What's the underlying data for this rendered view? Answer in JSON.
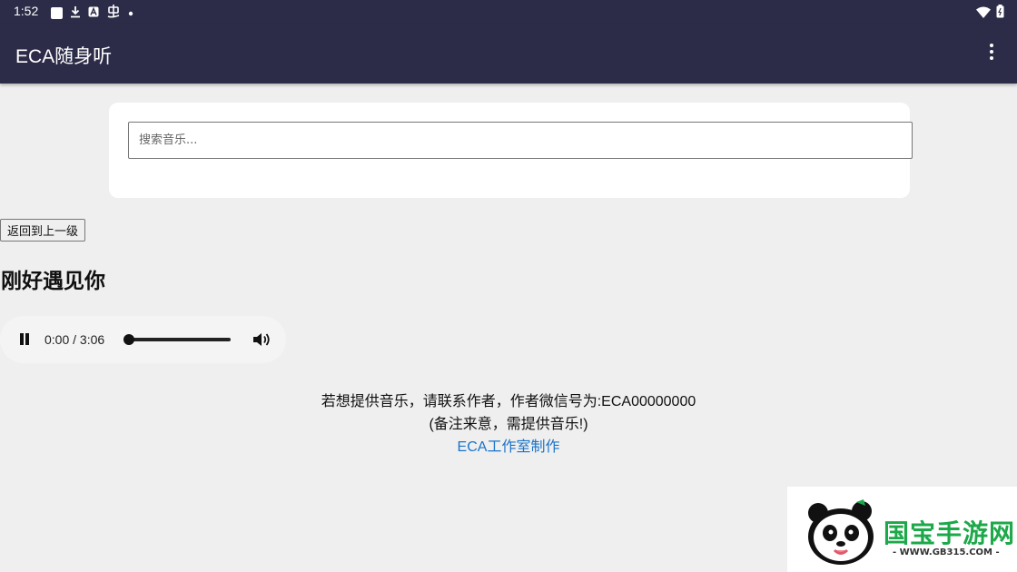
{
  "status_bar": {
    "time": "1:52",
    "left_icons": [
      "notification-square-icon",
      "download-icon",
      "a-box-icon",
      "bug-icon",
      "dot-icon"
    ],
    "right_icons": [
      "wifi-icon",
      "battery-icon"
    ]
  },
  "app_bar": {
    "title": "ECA随身听",
    "menu_icon": "more-vert-icon"
  },
  "search": {
    "placeholder": "搜索音乐..."
  },
  "back_button": {
    "label": "返回到上一级"
  },
  "song": {
    "title": "刚好遇见你"
  },
  "player": {
    "state_icon": "pause-icon",
    "time": "0:00 / 3:06",
    "progress": 0,
    "volume_icon": "volume-icon"
  },
  "footer": {
    "line1": "若想提供音乐，请联系作者，作者微信号为:ECA00000000",
    "line2": "(备注来意，需提供音乐!)",
    "link": "ECA工作室制作"
  },
  "watermark": {
    "logo": "panda-logo",
    "text": "国宝手游网",
    "url": "- WWW.GB315.COM -"
  },
  "colors": {
    "app_bar": "#2c2c48",
    "background": "#efefef",
    "link": "#1a73c8",
    "watermark_green": "#1da84a"
  }
}
